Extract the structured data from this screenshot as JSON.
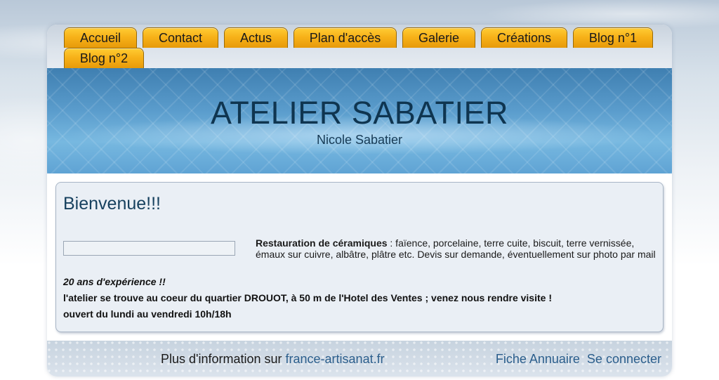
{
  "nav": {
    "tabs": [
      {
        "label": "Accueil"
      },
      {
        "label": "Contact"
      },
      {
        "label": "Actus"
      },
      {
        "label": "Plan d'accès"
      },
      {
        "label": "Galerie"
      },
      {
        "label": "Créations"
      },
      {
        "label": "Blog n°1"
      },
      {
        "label": "Blog n°2"
      }
    ]
  },
  "header": {
    "title": "ATELIER SABATIER",
    "subtitle": "Nicole Sabatier"
  },
  "main": {
    "heading": "Bienvenue!!!",
    "description_bold": "Restauration de céramiques",
    "description_rest": " : faïence, porcelaine, terre cuite, biscuit, terre vernissée, émaux sur cuivre, albâtre, plâtre etc.     Devis sur demande, éventuellement sur photo par mail",
    "experience": "20 ans d'expérience !!",
    "location": "l'atelier se trouve au coeur du quartier DROUOT, à 50 m de l'Hotel des Ventes ; venez nous rendre visite !",
    "hours": "ouvert du lundi au vendredi  10h/18h"
  },
  "footer": {
    "info_prefix": "Plus d'information sur ",
    "info_link": "france-artisanat.fr",
    "directory_link": "Fiche Annuaire",
    "login_link": "Se connecter"
  },
  "colors": {
    "tab_accent": "#f7b219",
    "banner": "#5a9ccc",
    "title": "#0f3550",
    "link": "#2b5e8c"
  }
}
